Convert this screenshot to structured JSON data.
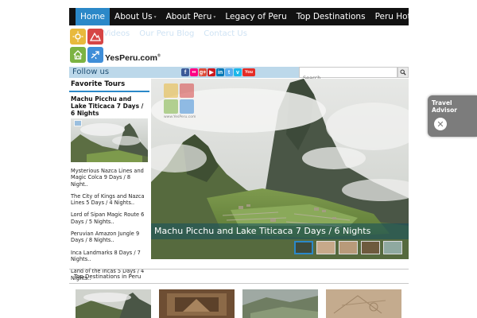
{
  "nav": {
    "items": [
      {
        "label": "Home",
        "active": true,
        "dropdown": false
      },
      {
        "label": "About Us",
        "active": false,
        "dropdown": true
      },
      {
        "label": "About Peru",
        "active": false,
        "dropdown": true
      },
      {
        "label": "Legacy of Peru",
        "active": false,
        "dropdown": false
      },
      {
        "label": "Top Destinations",
        "active": false,
        "dropdown": false
      },
      {
        "label": "Peru Hotels",
        "active": false,
        "dropdown": false
      }
    ]
  },
  "subnav": {
    "items": [
      "Videos",
      "Our Peru Blog",
      "Contact Us"
    ]
  },
  "logo": {
    "text": "YesPeru.com",
    "mark": "®"
  },
  "follow": {
    "label": "Follow us",
    "icons": [
      {
        "name": "facebook-icon",
        "glyph": "f",
        "color": "#3b5998"
      },
      {
        "name": "flickr-icon",
        "glyph": "••",
        "color": "#ff0084"
      },
      {
        "name": "google-plus-icon",
        "glyph": "g+",
        "color": "#dd4b39"
      },
      {
        "name": "youtube-small-icon",
        "glyph": "▶",
        "color": "#cc181e"
      },
      {
        "name": "linkedin-icon",
        "glyph": "in",
        "color": "#0077b5"
      },
      {
        "name": "twitter-icon",
        "glyph": "t",
        "color": "#55acee"
      },
      {
        "name": "vimeo-icon",
        "glyph": "v",
        "color": "#1ab7ea"
      },
      {
        "name": "youtube-icon",
        "glyph": "You",
        "color": "#e52d27"
      }
    ]
  },
  "search": {
    "placeholder": "Search..."
  },
  "sidebar": {
    "heading": "Favorite Tours",
    "featured_title": "Machu Picchu and Lake Titicaca 7 Days / 6 Nights",
    "tours": [
      "Mysterious Nazca Lines and Magic Colca 9 Days / 8 Night..",
      "The City of Kings and Nazca Lines 5 Days / 4 Nights..",
      "Lord of Sipan Magic Route 6 Days / 5 Nights..",
      "Peruvian Amazon Jungle 9 Days / 8 Nights..",
      "Inca Landmarks 8 Days / 7 Nights..",
      "Land of the Incas 5 Days / 4 Nights.."
    ]
  },
  "slider": {
    "caption": "Machu Picchu and Lake Titicaca 7 Days / 6 Nights",
    "watermark": "www.YesPeru.com",
    "active_thumb": 1,
    "thumb_count": 5
  },
  "advisor": {
    "label": "Travel Advisor",
    "close": "✕"
  },
  "bottom": {
    "heading": "Top Destinations in Peru",
    "card_count": 4
  },
  "colors": {
    "accent": "#2b88c8",
    "nav_bg": "#121212",
    "follow_bg": "#bcd8ea"
  }
}
